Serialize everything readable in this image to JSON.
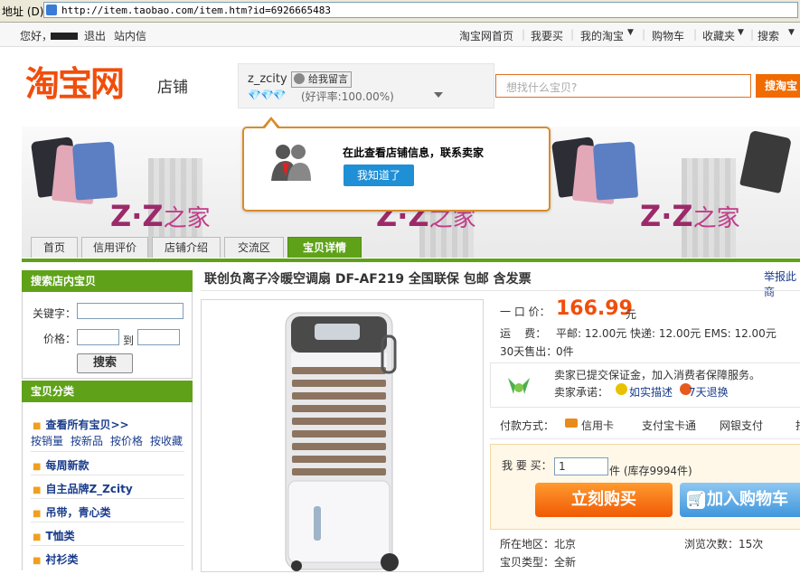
{
  "browser": {
    "address_label": "地址 (D)",
    "url": "http://item.taobao.com/item.htm?id=6926665483"
  },
  "topbar": {
    "greeting": "您好，",
    "logout": "退出",
    "inbox": "站内信",
    "links": [
      "淘宝网首页",
      "我要买",
      "我的淘宝",
      "购物车",
      "收藏夹",
      "搜索"
    ]
  },
  "header": {
    "logo": "淘宝网",
    "logo_sub": "店铺",
    "shop_name": "z_zcity",
    "message_btn": "给我留言",
    "diamonds": "💎💎💎",
    "rating": "(好评率:100.00%)",
    "search_placeholder": "想找什么宝贝?",
    "search_btn": "搜淘宝"
  },
  "banner": {
    "brand": "Z·Z",
    "brand_suffix": "之家"
  },
  "popover": {
    "text": "在此查看店铺信息，联系卖家",
    "button": "我知道了"
  },
  "tabs": [
    "首页",
    "信用评价",
    "店铺介绍",
    "交流区",
    "宝贝详情"
  ],
  "sidebar": {
    "search_title": "搜索店内宝贝",
    "keyword_label": "关键字：",
    "price_label": "价格：",
    "to_label": "到",
    "search_btn": "搜索",
    "category_title": "宝贝分类",
    "all_items": "查看所有宝贝>>",
    "sort_links": [
      "按销量",
      "按新品",
      "按价格",
      "按收藏"
    ],
    "categories": [
      "每周新款",
      "自主品牌Z_Zcity",
      "吊带，青心类",
      "T恤类",
      "衬衫类"
    ]
  },
  "product": {
    "title": "联创负离子冷暖空调扇 DF-AF219 全国联保 包邮 含发票",
    "report": "举报此商",
    "price_label": "一 口 价：",
    "price": "166.99",
    "price_unit": "元",
    "shipping_label": "运    费：",
    "shipping": "平邮: 12.00元 快递: 12.00元 EMS: 12.00元",
    "sold_label": "30天售出：",
    "sold": "0件",
    "guarantee_text": "卖家已提交保证金，加入消费者保障服务。",
    "promise_label": "卖家承诺：",
    "promise_1": "如实描述",
    "promise_2": "7天退换",
    "pay_label": "付款方式：",
    "pay_methods": [
      "信用卡",
      "支付宝卡通",
      "网银支付",
      "找"
    ],
    "qty_label": "我 要 买：",
    "qty_value": "1",
    "stock": "件 (库存9994件)",
    "buy_now": "立刻购买",
    "add_cart": "加入购物车",
    "region_label": "所在地区：",
    "region": "北京",
    "views_label": "浏览次数：",
    "views": "15次",
    "type_label": "宝贝类型：",
    "type": "全新"
  }
}
